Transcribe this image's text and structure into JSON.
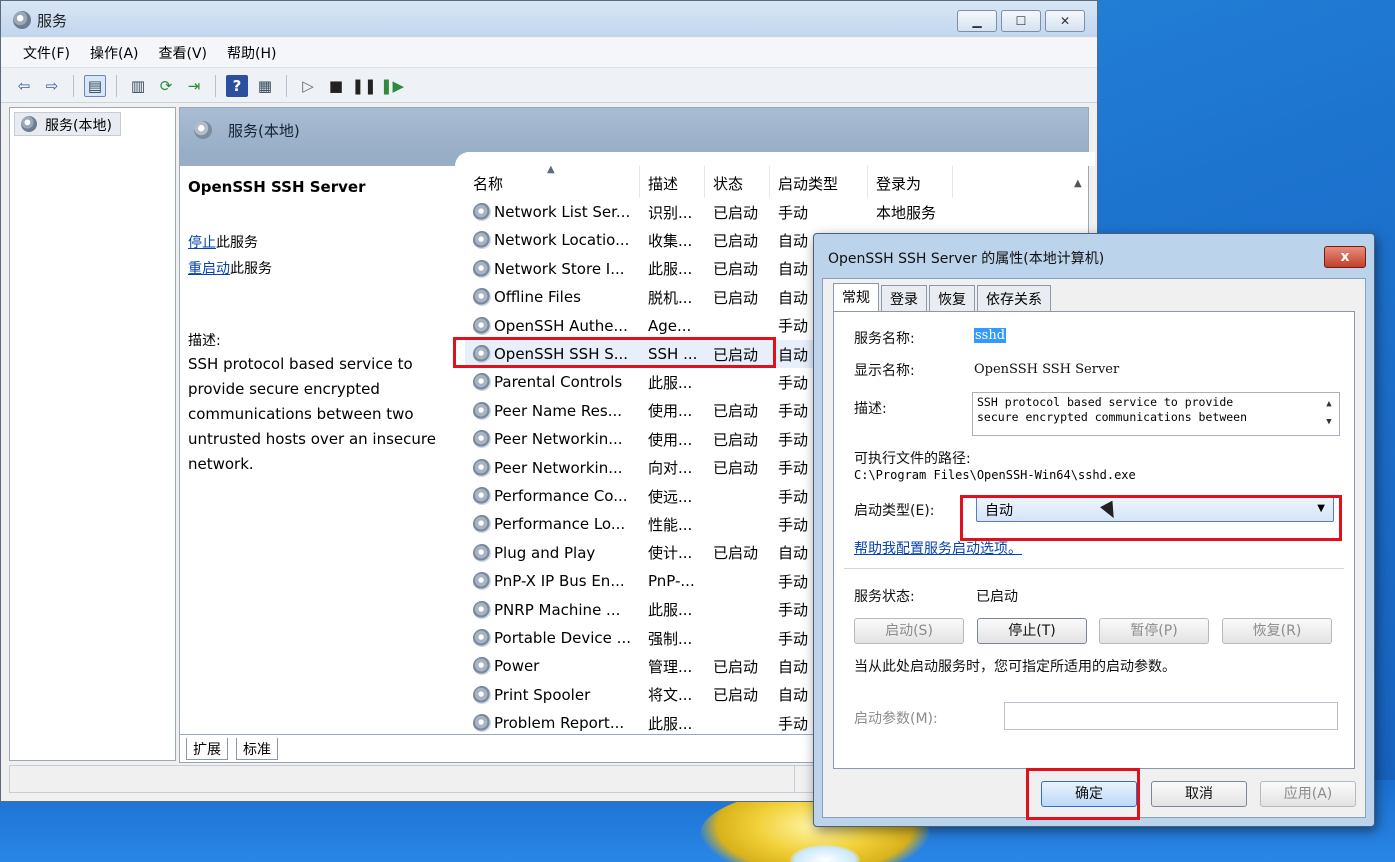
{
  "window": {
    "title": "服务"
  },
  "menu": [
    "文件(F)",
    "操作(A)",
    "查看(V)",
    "帮助(H)"
  ],
  "nav": {
    "root_label": "服务(本地)"
  },
  "content": {
    "header": "服务(本地)",
    "selected_service": "OpenSSH SSH Server",
    "actions": [
      {
        "link": "停止",
        "suffix": "此服务"
      },
      {
        "link": "重启动",
        "suffix": "此服务"
      }
    ],
    "description_label": "描述:",
    "description_lines": [
      "SSH protocol based service to",
      "provide secure encrypted",
      "communications between two",
      "untrusted hosts over an insecure",
      "network."
    ]
  },
  "list": {
    "columns": [
      "名称",
      "描述",
      "状态",
      "启动类型",
      "登录为"
    ],
    "rows": [
      {
        "name": "Network List Ser...",
        "desc": "识别...",
        "status": "已启动",
        "startup": "手动",
        "logon": "本地服务"
      },
      {
        "name": "Network Locatio...",
        "desc": "收集...",
        "status": "已启动",
        "startup": "自动",
        "logon": ""
      },
      {
        "name": "Network Store I...",
        "desc": "此服...",
        "status": "已启动",
        "startup": "自动",
        "logon": ""
      },
      {
        "name": "Offline Files",
        "desc": "脱机...",
        "status": "已启动",
        "startup": "自动",
        "logon": ""
      },
      {
        "name": "OpenSSH Authe...",
        "desc": "Age...",
        "status": "",
        "startup": "手动",
        "logon": ""
      },
      {
        "name": "OpenSSH SSH S...",
        "desc": "SSH ...",
        "status": "已启动",
        "startup": "自动",
        "logon": ""
      },
      {
        "name": "Parental Controls",
        "desc": "此服...",
        "status": "",
        "startup": "手动",
        "logon": ""
      },
      {
        "name": "Peer Name Res...",
        "desc": "使用...",
        "status": "已启动",
        "startup": "手动",
        "logon": ""
      },
      {
        "name": "Peer Networkin...",
        "desc": "使用...",
        "status": "已启动",
        "startup": "手动",
        "logon": ""
      },
      {
        "name": "Peer Networkin...",
        "desc": "向对...",
        "status": "已启动",
        "startup": "手动",
        "logon": ""
      },
      {
        "name": "Performance Co...",
        "desc": "使远...",
        "status": "",
        "startup": "手动",
        "logon": ""
      },
      {
        "name": "Performance Lo...",
        "desc": "性能...",
        "status": "",
        "startup": "手动",
        "logon": ""
      },
      {
        "name": "Plug and Play",
        "desc": "使计...",
        "status": "已启动",
        "startup": "自动",
        "logon": ""
      },
      {
        "name": "PnP-X IP Bus En...",
        "desc": "PnP-...",
        "status": "",
        "startup": "手动",
        "logon": ""
      },
      {
        "name": "PNRP Machine ...",
        "desc": "此服...",
        "status": "",
        "startup": "手动",
        "logon": ""
      },
      {
        "name": "Portable Device ...",
        "desc": "强制...",
        "status": "",
        "startup": "手动",
        "logon": ""
      },
      {
        "name": "Power",
        "desc": "管理...",
        "status": "已启动",
        "startup": "自动",
        "logon": ""
      },
      {
        "name": "Print Spooler",
        "desc": "将文...",
        "status": "已启动",
        "startup": "自动",
        "logon": ""
      },
      {
        "name": "Problem Report...",
        "desc": "此服...",
        "status": "",
        "startup": "手动",
        "logon": ""
      }
    ]
  },
  "bottom_tabs": [
    "扩展",
    "标准"
  ],
  "dialog": {
    "title": "OpenSSH SSH Server 的属性(本地计算机)",
    "close": "x",
    "tabs": [
      "常规",
      "登录",
      "恢复",
      "依存关系"
    ],
    "service_name_label": "服务名称:",
    "service_name": "sshd",
    "display_name_label": "显示名称:",
    "display_name": "OpenSSH SSH Server",
    "description_label": "描述:",
    "description_lines": [
      "SSH protocol based service to provide",
      "secure encrypted communications between"
    ],
    "exe_path_label": "可执行文件的路径:",
    "exe_path": "C:\\Program Files\\OpenSSH-Win64\\sshd.exe",
    "startup_type_label": "启动类型(E):",
    "startup_type": "自动",
    "help_link": "帮助我配置服务启动选项。",
    "status_label": "服务状态:",
    "status_value": "已启动",
    "buttons": {
      "start": "启动(S)",
      "stop": "停止(T)",
      "pause": "暂停(P)",
      "resume": "恢复(R)"
    },
    "hint": "当从此处启动服务时，您可指定所适用的启动参数。",
    "param_label": "启动参数(M):",
    "param_value": "",
    "ok": "确定",
    "cancel": "取消",
    "apply": "应用(A)"
  }
}
